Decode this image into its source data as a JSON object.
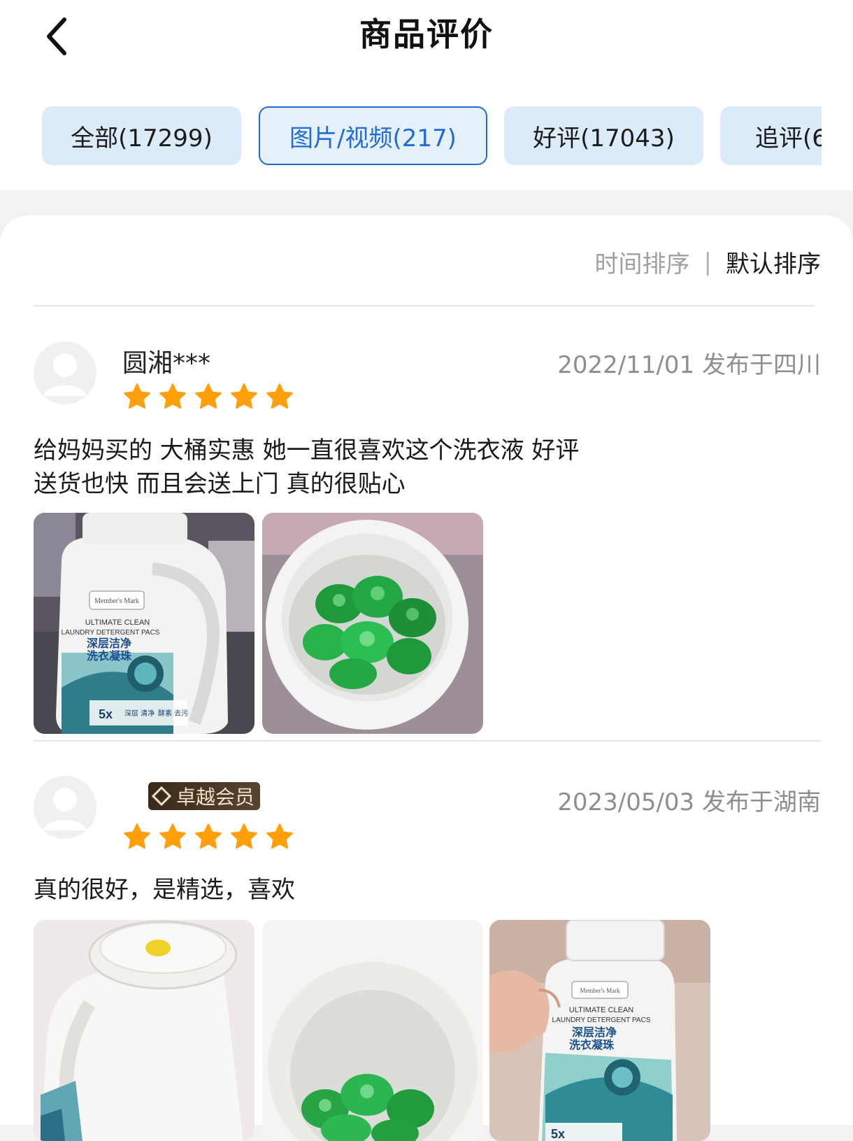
{
  "header": {
    "title": "商品评价"
  },
  "tabs": [
    {
      "label": "全部(17299)"
    },
    {
      "label": "图片/视频(217)"
    },
    {
      "label": "好评(17043)"
    },
    {
      "label": "追评(6"
    }
  ],
  "sort": {
    "time_label": "时间排序",
    "separator": "|",
    "default_label": "默认排序"
  },
  "reviews": [
    {
      "username": "圆湘***",
      "date_location": "2022/11/01  发布于四川",
      "rating": 5,
      "content_line1": "给妈妈买的 大桶实惠 她一直很喜欢这个洗衣液 好评",
      "content_line2": "送货也快 而且会送上门 真的很贴心",
      "photos": [
        {
          "label": "detergent-bottle-photo",
          "text": [
            "Member's Mark",
            "ULTIMATE CLEAN",
            "LAUNDRY DETERGENT PACS",
            "深层洁净",
            "洗衣凝珠",
            "5x",
            "深层 清净",
            "酵素 去污"
          ]
        },
        {
          "label": "detergent-pods-in-tub-photo"
        }
      ]
    },
    {
      "badge": "卓越会员",
      "date_location": "2023/05/03  发布于湖南",
      "rating": 5,
      "content_line1": "真的很好，是精选，喜欢",
      "photos": [
        {
          "label": "bottle-lid-photo"
        },
        {
          "label": "pods-close-up-photo"
        },
        {
          "label": "hand-holding-bottle-photo",
          "text": [
            "Member's Mark",
            "ULTIMATE CLEAN",
            "LAUNDRY DETERGENT PACS",
            "深层洁净",
            "洗衣凝珠",
            "5x"
          ]
        }
      ]
    }
  ],
  "colors": {
    "accent": "#1f6bd8",
    "tab_bg": "#dcebfa",
    "star": "#ff9f0a"
  },
  "icons": {
    "back": "chevron-left-icon",
    "star": "star-icon",
    "avatar": "default-avatar-icon",
    "badge": "diamond-icon"
  }
}
